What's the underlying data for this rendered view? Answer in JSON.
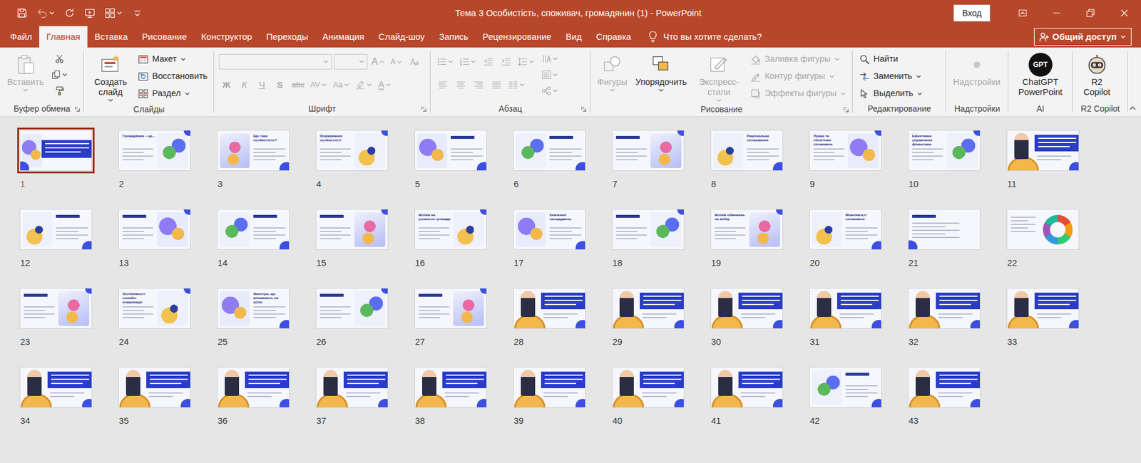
{
  "window": {
    "title": "Тема 3 Особистість, споживач, громадянин (1) - PowerPoint",
    "sign_in": "Вход"
  },
  "menu_tabs": [
    {
      "label": "Файл",
      "selected": false
    },
    {
      "label": "Главная",
      "selected": true
    },
    {
      "label": "Вставка",
      "selected": false
    },
    {
      "label": "Рисование",
      "selected": false
    },
    {
      "label": "Конструктор",
      "selected": false
    },
    {
      "label": "Переходы",
      "selected": false
    },
    {
      "label": "Анимация",
      "selected": false
    },
    {
      "label": "Слайд-шоу",
      "selected": false
    },
    {
      "label": "Запись",
      "selected": false
    },
    {
      "label": "Рецензирование",
      "selected": false
    },
    {
      "label": "Вид",
      "selected": false
    },
    {
      "label": "Справка",
      "selected": false
    }
  ],
  "tell_me": {
    "label": "Что вы хотите сделать?"
  },
  "share": {
    "label": "Общий доступ"
  },
  "ribbon": {
    "groups": [
      {
        "label": "Буфер обмена",
        "launcher": true,
        "columns": [
          [
            {
              "kind": "large",
              "label": "Вставить",
              "disabled": true,
              "dropdown": true
            }
          ],
          [
            {
              "kind": "icon",
              "disabled": false,
              "dropdown": false
            },
            {
              "kind": "icon",
              "disabled": false,
              "dropdown": true
            },
            {
              "kind": "icon",
              "disabled": false,
              "dropdown": false
            }
          ]
        ]
      },
      {
        "label": "Слайды",
        "launcher": false,
        "columns": [
          [
            {
              "kind": "large",
              "label": "Создать слайд",
              "disabled": false,
              "dropdown": true
            }
          ],
          [
            {
              "kind": "small",
              "label": "Макет",
              "disabled": false,
              "dropdown": true
            },
            {
              "kind": "small",
              "label": "Восстановить",
              "disabled": false,
              "dropdown": false
            },
            {
              "kind": "small",
              "label": "Раздел",
              "disabled": false,
              "dropdown": true
            }
          ]
        ]
      },
      {
        "label": "Шрифт",
        "launcher": true,
        "columns": [
          [
            {
              "kind": "row",
              "items": [
                {
                  "kind": "field",
                  "disabled": true,
                  "dropdown": true
                },
                {
                  "kind": "field",
                  "disabled": true,
                  "dropdown": true
                },
                {
                  "kind": "glyph",
                  "text": "A",
                  "disabled": true,
                  "dropdown": false
                },
                {
                  "kind": "glyph",
                  "text": "A",
                  "disabled": true,
                  "dropdown": false
                },
                {
                  "kind": "icon",
                  "disabled": true,
                  "dropdown": false
                }
              ]
            },
            {
              "kind": "row",
              "items": [
                {
                  "kind": "glyph",
                  "text": "Ж",
                  "disabled": true,
                  "dropdown": false
                },
                {
                  "kind": "glyph",
                  "text": "К",
                  "disabled": true,
                  "dropdown": false
                },
                {
                  "kind": "glyph",
                  "text": "Ч",
                  "disabled": true,
                  "dropdown": false
                },
                {
                  "kind": "glyph",
                  "text": "S",
                  "disabled": true,
                  "dropdown": false
                },
                {
                  "kind": "glyph",
                  "text": "abc",
                  "disabled": true,
                  "dropdown": false
                },
                {
                  "kind": "glyph",
                  "text": "AV",
                  "disabled": true,
                  "dropdown": true
                },
                {
                  "kind": "glyph",
                  "text": "Aa",
                  "disabled": true,
                  "dropdown": true
                },
                {
                  "kind": "icon",
                  "disabled": true,
                  "dropdown": true
                },
                {
                  "kind": "glyph",
                  "text": "A",
                  "disabled": true,
                  "dropdown": true
                }
              ]
            }
          ]
        ]
      },
      {
        "label": "Абзац",
        "launcher": true,
        "columns": [
          [
            {
              "kind": "row",
              "items": [
                {
                  "kind": "icon",
                  "disabled": true,
                  "dropdown": true
                },
                {
                  "kind": "icon",
                  "disabled": true,
                  "dropdown": true
                },
                {
                  "kind": "icon",
                  "disabled": true,
                  "dropdown": false
                },
                {
                  "kind": "icon",
                  "disabled": true,
                  "dropdown": false
                },
                {
                  "kind": "icon",
                  "disabled": true,
                  "dropdown": true
                }
              ]
            },
            {
              "kind": "row",
              "items": [
                {
                  "kind": "icon",
                  "disabled": true,
                  "dropdown": false
                },
                {
                  "kind": "icon",
                  "disabled": true,
                  "dropdown": false
                },
                {
                  "kind": "icon",
                  "disabled": true,
                  "dropdown": false
                },
                {
                  "kind": "icon",
                  "disabled": true,
                  "dropdown": false
                },
                {
                  "kind": "icon",
                  "disabled": true,
                  "dropdown": true
                }
              ]
            }
          ],
          [
            {
              "kind": "icon",
              "disabled": true,
              "dropdown": true
            },
            {
              "kind": "icon",
              "disabled": true,
              "dropdown": true
            },
            {
              "kind": "icon",
              "disabled": true,
              "dropdown": true
            }
          ]
        ]
      },
      {
        "label": "Рисование",
        "launcher": true,
        "columns": [
          [
            {
              "kind": "large",
              "label": "Фигуры",
              "disabled": true,
              "dropdown": true
            }
          ],
          [
            {
              "kind": "large",
              "label": "Упорядочить",
              "disabled": false,
              "dropdown": true
            }
          ],
          [
            {
              "kind": "large",
              "label": "Экспресс-стили",
              "disabled": true,
              "dropdown": true
            }
          ],
          [
            {
              "kind": "small",
              "label": "Заливка фигуры",
              "disabled": true,
              "dropdown": true
            },
            {
              "kind": "small",
              "label": "Контур фигуры",
              "disabled": true,
              "dropdown": true
            },
            {
              "kind": "small",
              "label": "Эффекты фигуры",
              "disabled": true,
              "dropdown": true
            }
          ]
        ]
      },
      {
        "label": "Редактирование",
        "launcher": false,
        "columns": [
          [
            {
              "kind": "small",
              "label": "Найти",
              "disabled": false,
              "dropdown": false
            },
            {
              "kind": "small",
              "label": "Заменить",
              "disabled": false,
              "dropdown": true
            },
            {
              "kind": "small",
              "label": "Выделить",
              "disabled": false,
              "dropdown": true
            }
          ]
        ]
      },
      {
        "label": "Надстройки",
        "launcher": false,
        "columns": [
          [
            {
              "kind": "large",
              "label": "Надстройки",
              "disabled": true,
              "dropdown": false
            }
          ]
        ]
      },
      {
        "label": "AI",
        "launcher": false,
        "columns": [
          [
            {
              "kind": "large",
              "label": "ChatGPT PowerPoint",
              "logo": "GPT",
              "disabled": false,
              "dropdown": false
            }
          ]
        ]
      },
      {
        "label": "R2 Copilot",
        "launcher": false,
        "columns": [
          [
            {
              "kind": "large",
              "label": "R2 Copilot",
              "disabled": false,
              "dropdown": false
            }
          ]
        ]
      }
    ]
  },
  "slides": [
    {
      "number": "1",
      "selected": true,
      "kind": "cover"
    },
    {
      "number": "2",
      "selected": false,
      "kind": "image-right",
      "title": "Громадянин – це..."
    },
    {
      "number": "3",
      "selected": false,
      "kind": "image-left",
      "title": "Що таке особистість?"
    },
    {
      "number": "4",
      "selected": false,
      "kind": "image-right",
      "title": "Формування особистості"
    },
    {
      "number": "5",
      "selected": false,
      "kind": "image-left"
    },
    {
      "number": "6",
      "selected": false,
      "kind": "image-left"
    },
    {
      "number": "7",
      "selected": false,
      "kind": "image-right"
    },
    {
      "number": "8",
      "selected": false,
      "kind": "image-left",
      "title": "Раціональне споживання"
    },
    {
      "number": "9",
      "selected": false,
      "kind": "image-right",
      "title": "Права та обов'язки споживача"
    },
    {
      "number": "10",
      "selected": false,
      "kind": "image-right",
      "title": "Ефективне управління фінансами"
    },
    {
      "number": "11",
      "selected": false,
      "kind": "banner"
    },
    {
      "number": "12",
      "selected": false,
      "kind": "image-left"
    },
    {
      "number": "13",
      "selected": false,
      "kind": "image-right"
    },
    {
      "number": "14",
      "selected": false,
      "kind": "image-left"
    },
    {
      "number": "15",
      "selected": false,
      "kind": "image-right"
    },
    {
      "number": "16",
      "selected": false,
      "kind": "image-right",
      "title": "Вплив на розвиток громади"
    },
    {
      "number": "17",
      "selected": false,
      "kind": "image-left",
      "title": "Значення заощаджень"
    },
    {
      "number": "18",
      "selected": false,
      "kind": "image-right"
    },
    {
      "number": "19",
      "selected": false,
      "kind": "image-right",
      "title": "Вплив обмежень на вибір"
    },
    {
      "number": "20",
      "selected": false,
      "kind": "image-left",
      "title": "Можливості споживача"
    },
    {
      "number": "21",
      "selected": false,
      "kind": "text"
    },
    {
      "number": "22",
      "selected": false,
      "kind": "diagram"
    },
    {
      "number": "23",
      "selected": false,
      "kind": "image-right"
    },
    {
      "number": "24",
      "selected": false,
      "kind": "image-right",
      "title": "Особливості онлайн-комунікації"
    },
    {
      "number": "25",
      "selected": false,
      "kind": "image-left",
      "title": "Фактори, що впливають на успіх"
    },
    {
      "number": "26",
      "selected": false,
      "kind": "image-right"
    },
    {
      "number": "27",
      "selected": false,
      "kind": "image-right"
    },
    {
      "number": "28",
      "selected": false,
      "kind": "banner"
    },
    {
      "number": "29",
      "selected": false,
      "kind": "banner"
    },
    {
      "number": "30",
      "selected": false,
      "kind": "banner"
    },
    {
      "number": "31",
      "selected": false,
      "kind": "banner"
    },
    {
      "number": "32",
      "selected": false,
      "kind": "banner"
    },
    {
      "number": "33",
      "selected": false,
      "kind": "banner"
    },
    {
      "number": "34",
      "selected": false,
      "kind": "banner"
    },
    {
      "number": "35",
      "selected": false,
      "kind": "banner"
    },
    {
      "number": "36",
      "selected": false,
      "kind": "banner"
    },
    {
      "number": "37",
      "selected": false,
      "kind": "banner"
    },
    {
      "number": "38",
      "selected": false,
      "kind": "banner"
    },
    {
      "number": "39",
      "selected": false,
      "kind": "banner"
    },
    {
      "number": "40",
      "selected": false,
      "kind": "banner"
    },
    {
      "number": "41",
      "selected": false,
      "kind": "banner"
    },
    {
      "number": "42",
      "selected": false,
      "kind": "image-left"
    },
    {
      "number": "43",
      "selected": false,
      "kind": "banner"
    }
  ]
}
